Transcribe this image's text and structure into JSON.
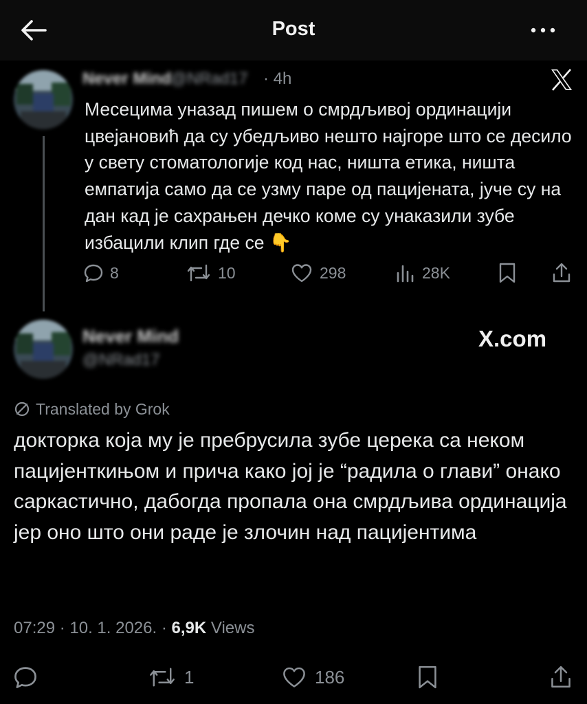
{
  "header": {
    "title": "Post"
  },
  "quoted_post": {
    "display_name": "Never Mind",
    "handle": "@NRad17",
    "time": "· 4h",
    "text": "Месецима уназад пишем о смрдљивој ординацији цвејановић да су убедљиво нешто најгоре што се десило у свету стоматологије код нас, ништа етика, ништа емпатија само да се узму паре од пацијената, јуче су на дан кад је сахрањен дечко коме су унаказили зубе избацили клип где се",
    "emoji": "👇",
    "stats": {
      "replies": "8",
      "reposts": "10",
      "likes": "298",
      "views": "28K"
    }
  },
  "post": {
    "display_name": "Never Mind",
    "handle": "@NRad17",
    "source_badge": "X.com",
    "translated_label": "Translated by Grok",
    "text": "докторка која му је пребрусила зубе церека са неком пацијенткињом и прича како јој је “радила о глави” онако саркастично, дабогда пропала она смрдљива ординација јер оно што они раде је злочин над пацијентима",
    "timestamp": "07:29 · 10. 1. 2026. ·",
    "views_count": "6,9K",
    "views_label": "Views",
    "stats": {
      "reposts": "1",
      "likes": "186"
    }
  },
  "colors": {
    "background": "#000000",
    "text": "#e7e9ea",
    "muted": "#8b9096"
  },
  "icons": [
    "back-arrow-icon",
    "more-icon",
    "x-logo-icon",
    "reply-icon",
    "repost-icon",
    "like-icon",
    "views-icon",
    "bookmark-icon",
    "share-icon",
    "grok-translate-icon"
  ]
}
